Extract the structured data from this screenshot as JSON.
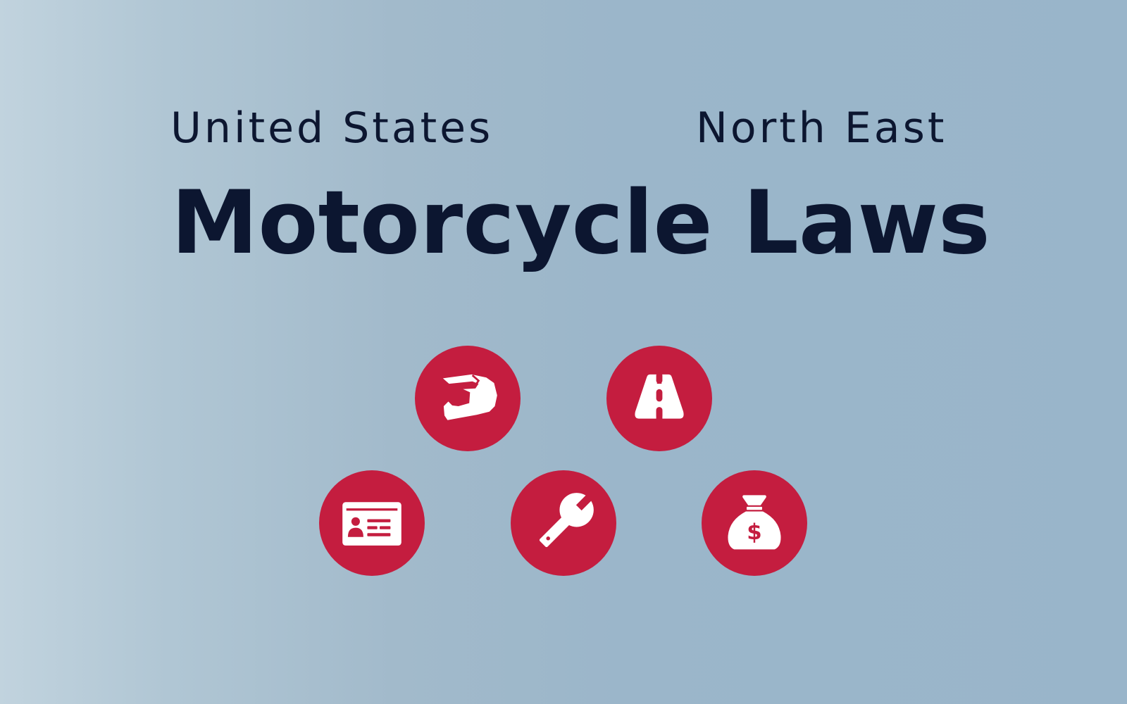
{
  "header": {
    "left": "United States",
    "right": "North East",
    "title": "Motorcycle Laws"
  },
  "icons": [
    {
      "name": "helmet-icon"
    },
    {
      "name": "road-icon"
    },
    {
      "name": "license-icon"
    },
    {
      "name": "wrench-icon"
    },
    {
      "name": "money-bag-icon"
    }
  ],
  "colors": {
    "text": "#0c1630",
    "accent": "#c41d3f",
    "icon": "#ffffff",
    "background_left": "#c1d3de",
    "background_right": "#99b5ca"
  }
}
